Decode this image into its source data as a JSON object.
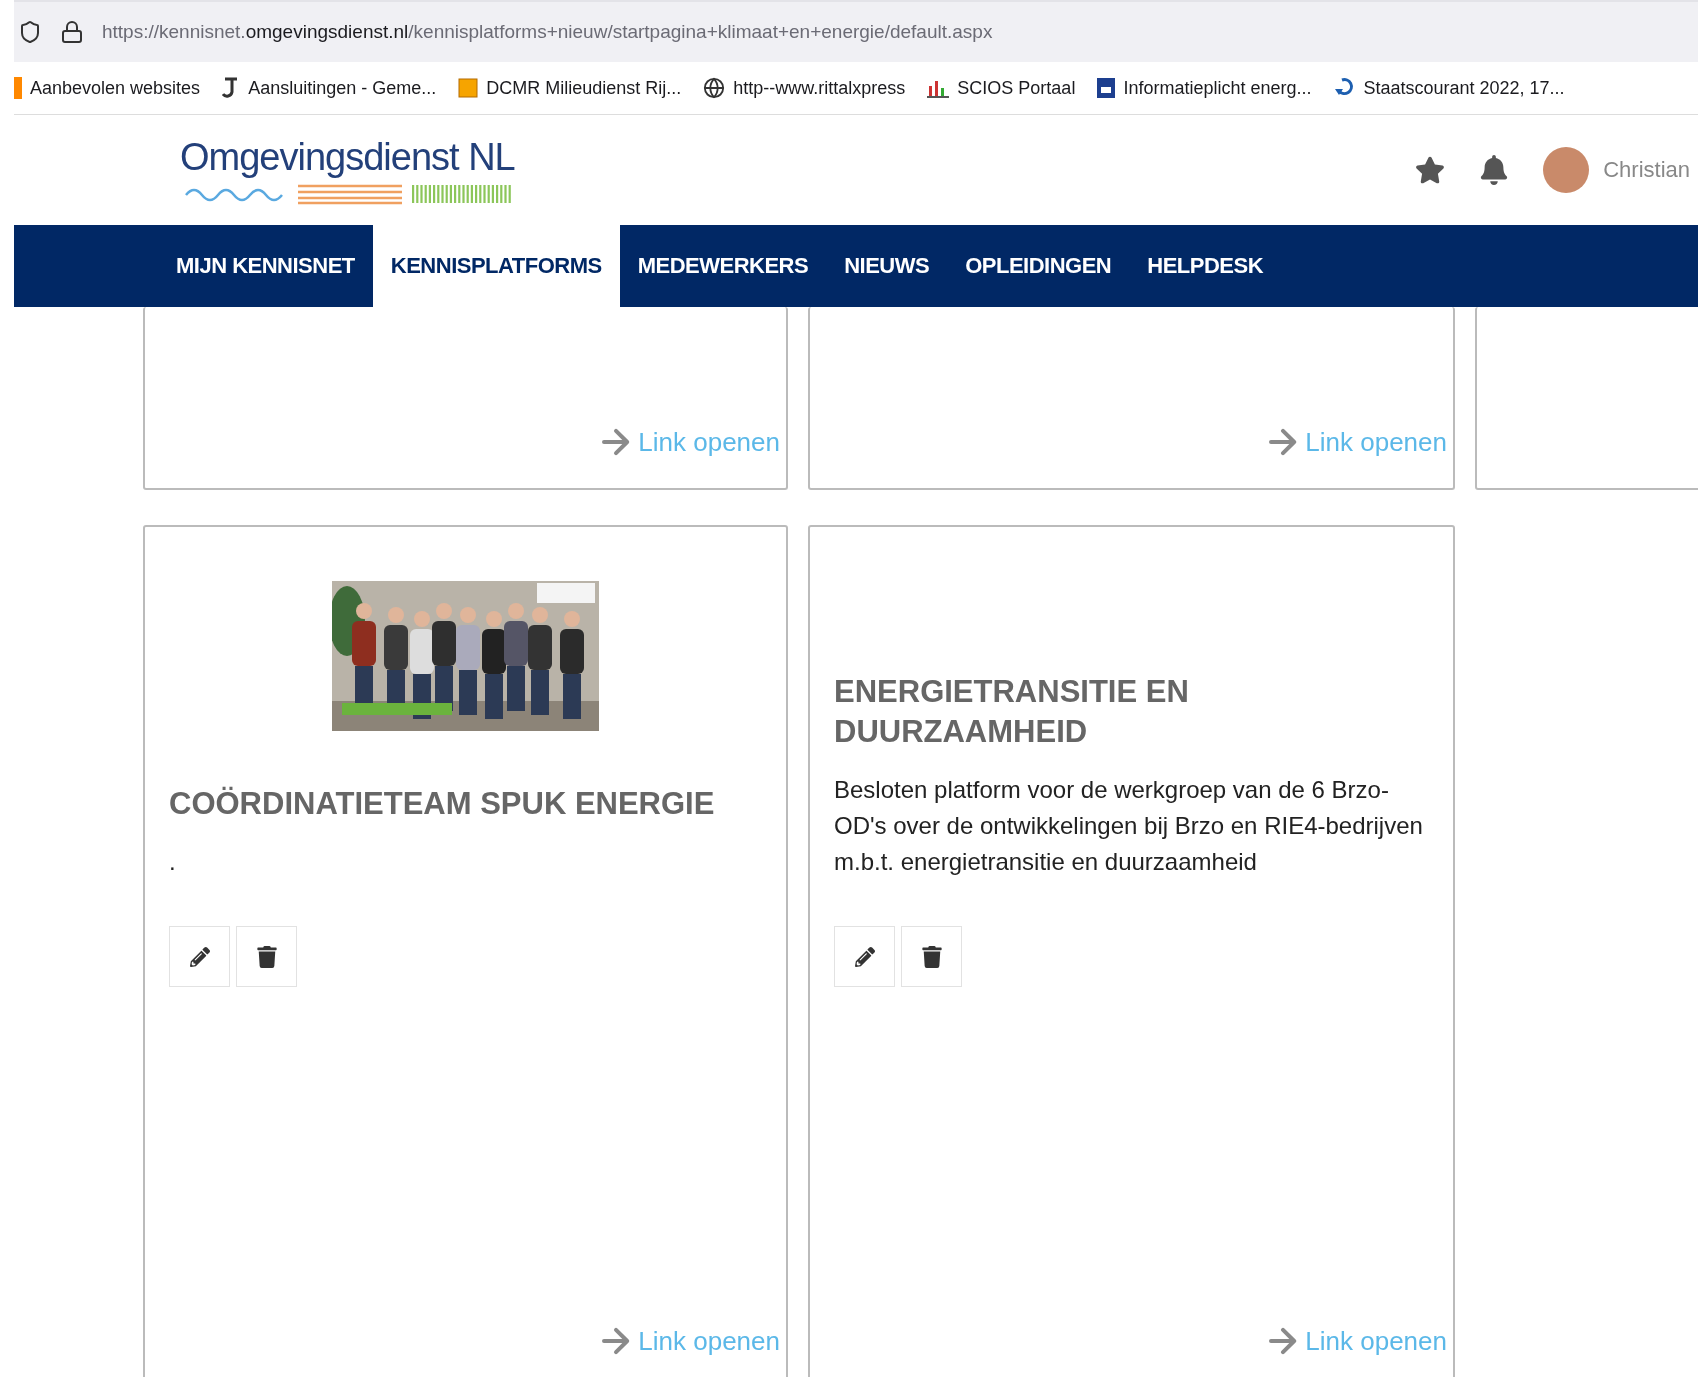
{
  "browser": {
    "url": {
      "host_start": "https://kennisnet.",
      "domain": "omgevingsdienst.nl",
      "path": "/kennisplatforms+nieuw/startpagina+klimaat+en+energie/default.aspx"
    }
  },
  "bookmarks": [
    {
      "label": "Aanbevolen websites",
      "kind": "flag"
    },
    {
      "label": "Aansluitingen - Geme...",
      "kind": "hook"
    },
    {
      "label": "DCMR Milieudienst Rij...",
      "kind": "tile"
    },
    {
      "label": "http--www.rittalxpress",
      "kind": "globe"
    },
    {
      "label": "SCIOS Portaal",
      "kind": "chart"
    },
    {
      "label": "Informatieplicht energ...",
      "kind": "badge"
    },
    {
      "label": "Staatscourant 2022, 17...",
      "kind": "refresh"
    }
  ],
  "header": {
    "logo": "Omgevingsdienst NL",
    "user": "Christian"
  },
  "nav": [
    {
      "label": "MIJN KENNISNET",
      "selected": false
    },
    {
      "label": "KENNISPLATFORMS",
      "selected": true
    },
    {
      "label": "MEDEWERKERS",
      "selected": false
    },
    {
      "label": "NIEUWS",
      "selected": false
    },
    {
      "label": "OPLEIDINGEN",
      "selected": false
    },
    {
      "label": "HELPDESK",
      "selected": false
    }
  ],
  "rows": [
    {
      "cards": [
        {
          "kind": "blank",
          "link": "Link openen"
        },
        {
          "kind": "blank",
          "link": "Link openen"
        },
        {
          "kind": "edge"
        }
      ]
    },
    {
      "cards": [
        {
          "kind": "platform",
          "title": "COÖRDINATIETEAM SPUK ENERGIE",
          "description": ".",
          "link": "Link openen"
        },
        {
          "kind": "platform",
          "title": "ENERGIETRANSITIE EN DUURZAAMHEID",
          "description": "Besloten platform voor de werkgroep van de 6 Brzo-OD's over de ontwikkelingen bij Brzo en RIE4-bedrijven m.b.t. energietransitie en duurzaamheid",
          "link": "Link openen"
        }
      ]
    }
  ]
}
